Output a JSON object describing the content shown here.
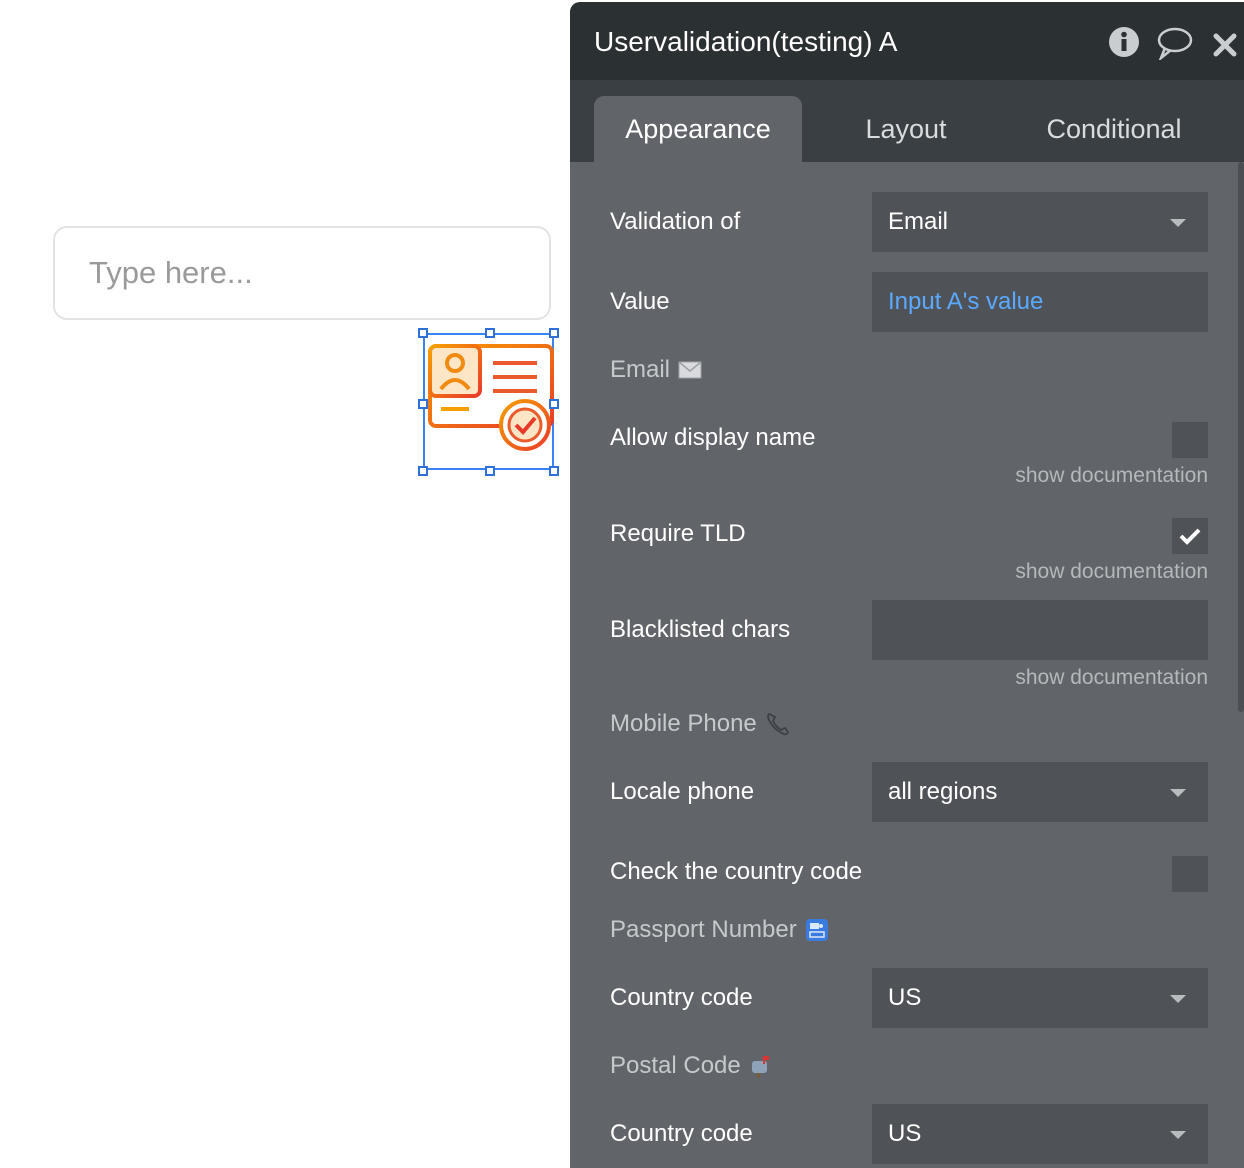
{
  "canvas": {
    "input_placeholder": "Type here..."
  },
  "panel": {
    "title": "Uservalidation(testing) A",
    "header_icons": [
      "info-icon",
      "comment-icon",
      "close-icon"
    ],
    "tabs": [
      {
        "label": "Appearance",
        "active": true
      },
      {
        "label": "Layout",
        "active": false
      },
      {
        "label": "Conditional",
        "active": false
      }
    ],
    "validation_of": {
      "label": "Validation of",
      "value": "Email"
    },
    "value": {
      "label": "Value",
      "value": "Input A's value"
    },
    "email_section": {
      "label": "Email",
      "icon": "envelope-icon"
    },
    "allow_display_name": {
      "label": "Allow display name",
      "checked": false,
      "doc": "show documentation"
    },
    "require_tld": {
      "label": "Require TLD",
      "checked": true,
      "doc": "show documentation"
    },
    "blacklisted_chars": {
      "label": "Blacklisted chars",
      "value": "",
      "doc": "show documentation"
    },
    "mobile_section": {
      "label": "Mobile Phone",
      "icon": "phone-icon"
    },
    "locale_phone": {
      "label": "Locale phone",
      "value": "all regions"
    },
    "check_country_code": {
      "label": "Check the country code",
      "checked": false
    },
    "passport_section": {
      "label": "Passport Number",
      "icon": "passport-control-icon"
    },
    "passport_country_code": {
      "label": "Country code",
      "value": "US"
    },
    "postal_section": {
      "label": "Postal Code",
      "icon": "mailbox-icon"
    },
    "postal_country_code": {
      "label": "Country code",
      "value": "US"
    }
  },
  "colors": {
    "panel_bg": "#61656a",
    "header_bg": "#2b3033",
    "tabs_bg": "#3a3f43",
    "field_bg": "#4f5358",
    "dynamic_value": "#5aa9ff",
    "selection": "#3b82f6"
  }
}
